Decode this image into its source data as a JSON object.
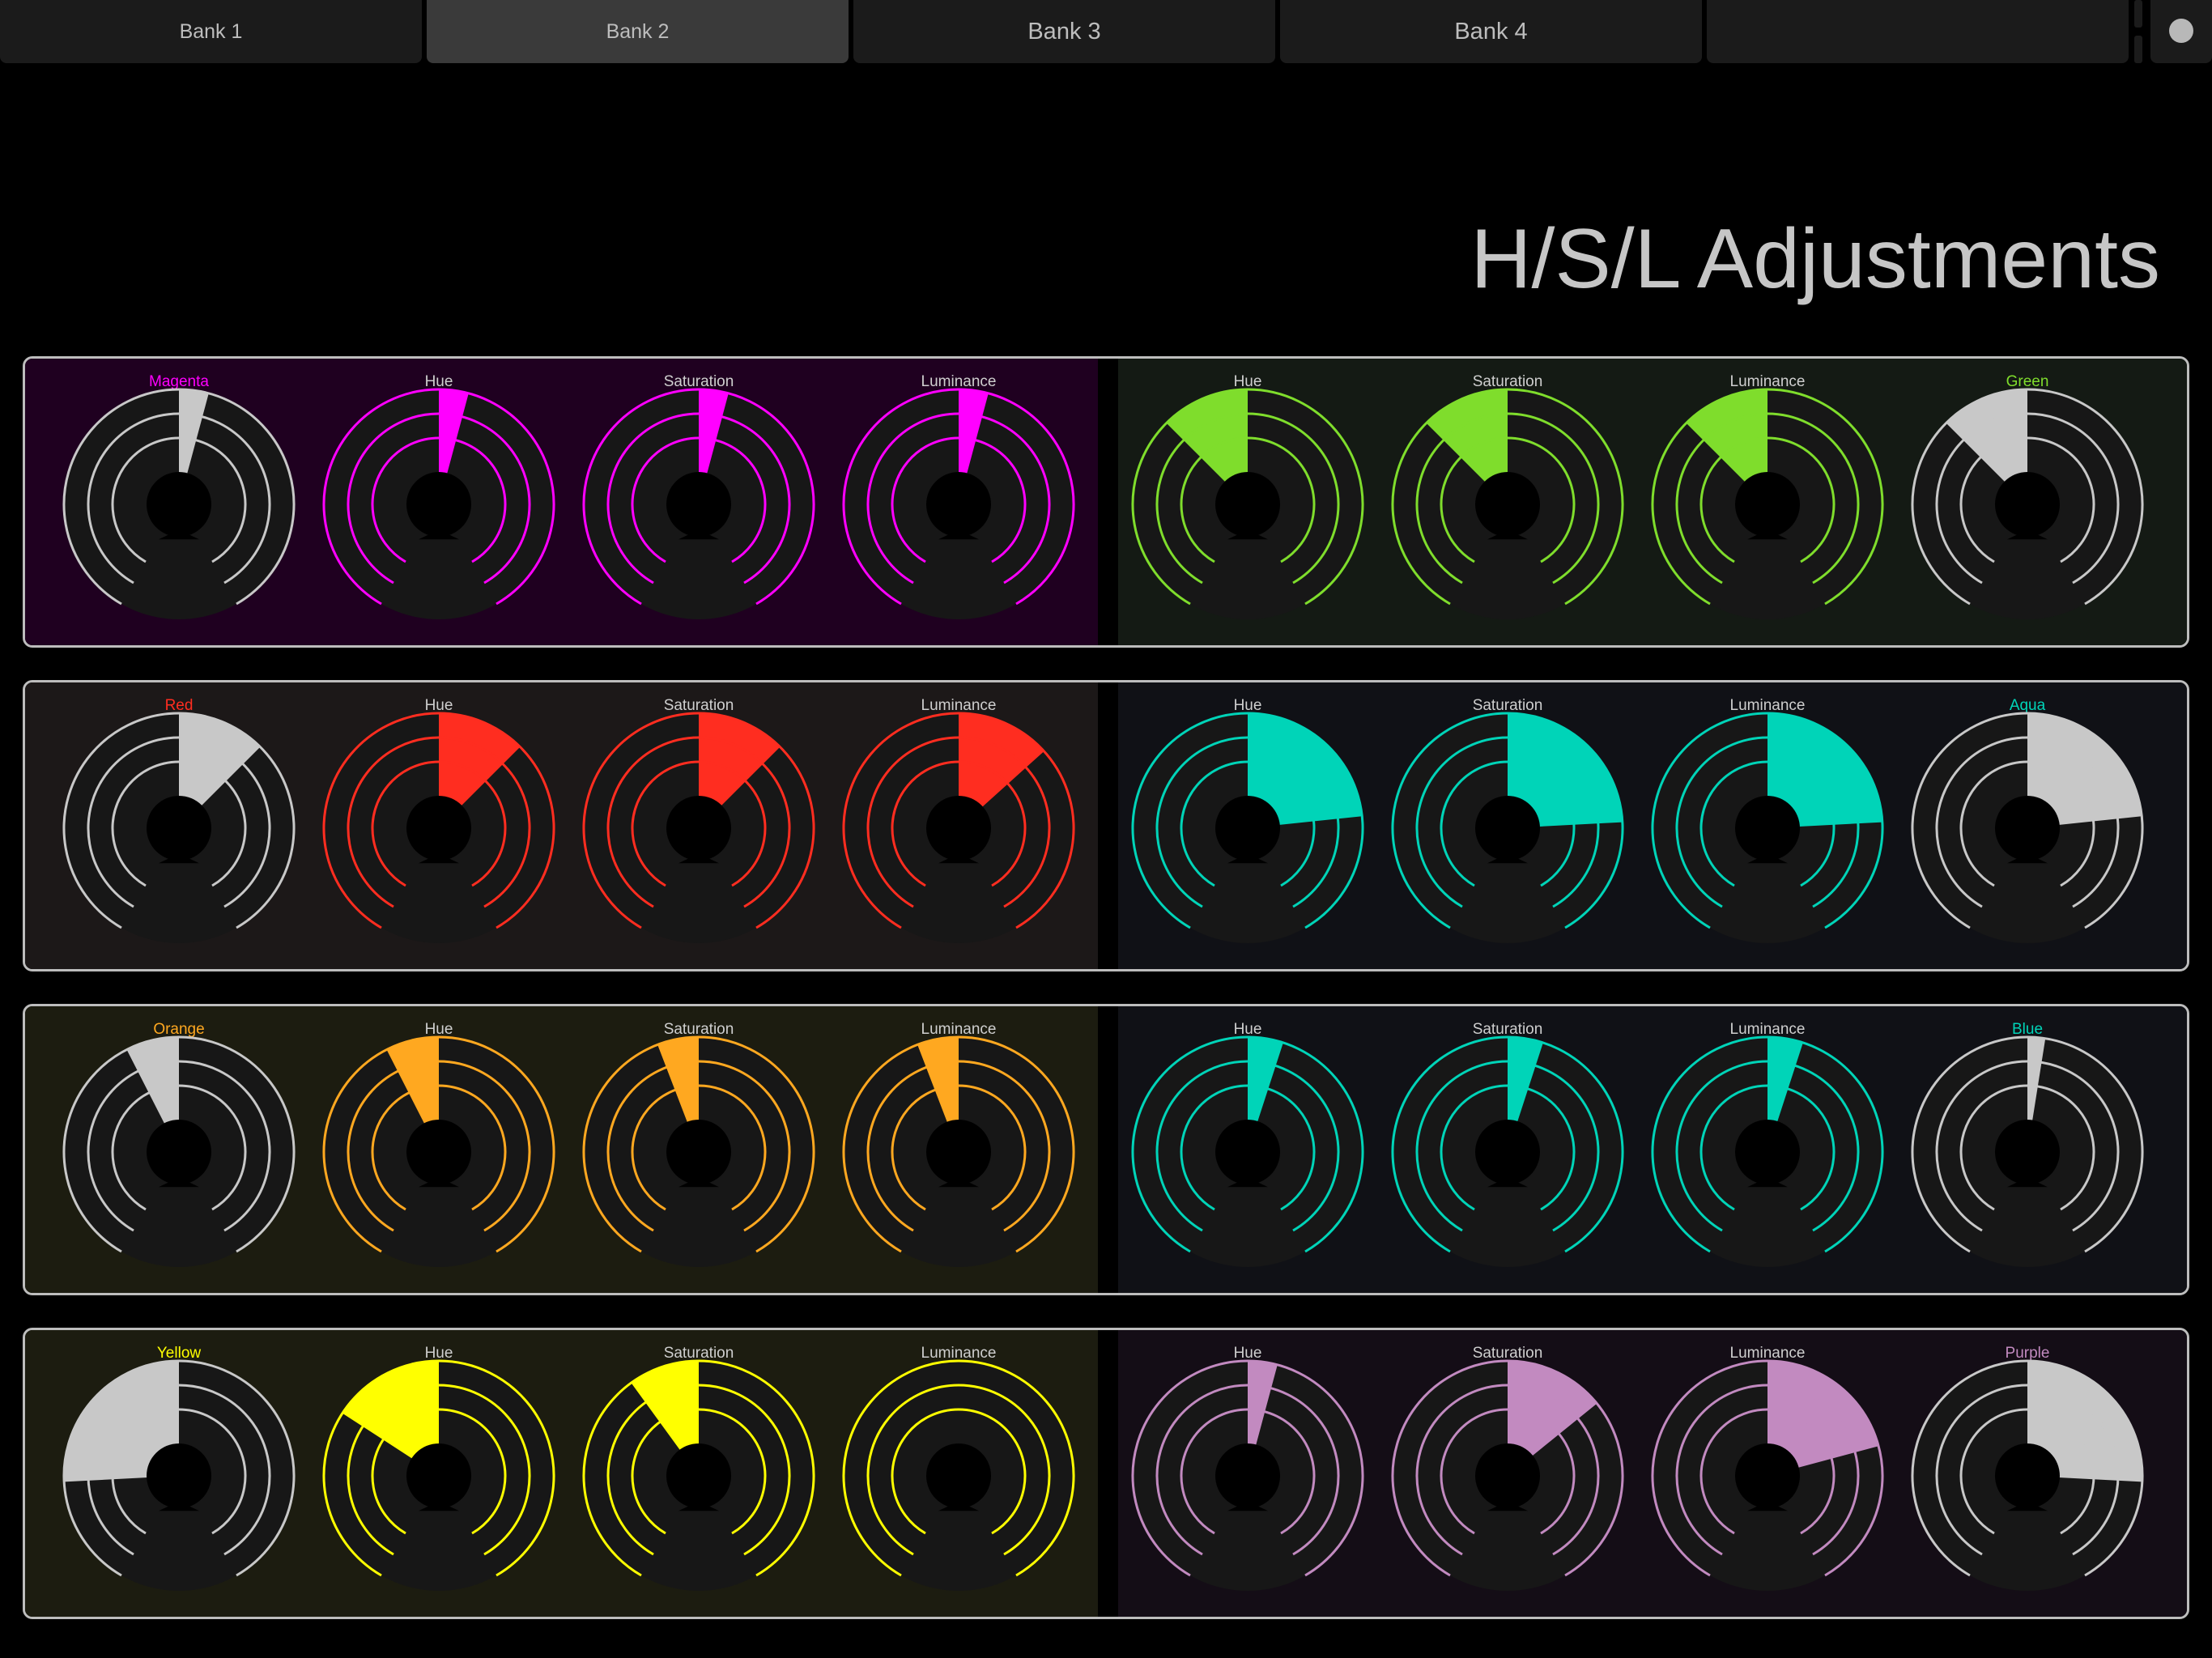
{
  "tabs": [
    {
      "label": "Bank 1",
      "active": false
    },
    {
      "label": "Bank 2",
      "active": true
    },
    {
      "label": "Bank 3",
      "active": false
    },
    {
      "label": "Bank 4",
      "active": false
    },
    {
      "label": "",
      "active": false
    }
  ],
  "status_icon": "circle-indicator-icon",
  "title": "H/S/L Adjustments",
  "rows": [
    {
      "left": {
        "bg": "#1f0020",
        "color": "#ff00ff",
        "name": "Magenta",
        "knobs": [
          {
            "label": "Magenta",
            "value": 0.55,
            "selector": true
          },
          {
            "label": "Hue",
            "value": 0.55
          },
          {
            "label": "Saturation",
            "value": 0.55
          },
          {
            "label": "Luminance",
            "value": 0.55
          }
        ]
      },
      "right": {
        "bg": "#141a14",
        "color": "#7fdd2c",
        "name": "Green",
        "knobs": [
          {
            "label": "Hue",
            "value": 0.35
          },
          {
            "label": "Saturation",
            "value": 0.35
          },
          {
            "label": "Luminance",
            "value": 0.35
          },
          {
            "label": "Green",
            "value": 0.35,
            "selector": true
          }
        ]
      }
    },
    {
      "left": {
        "bg": "#1c1818",
        "color": "#ff2d20",
        "name": "Red",
        "knobs": [
          {
            "label": "Red",
            "value": 0.65,
            "selector": true
          },
          {
            "label": "Hue",
            "value": 0.65
          },
          {
            "label": "Saturation",
            "value": 0.65
          },
          {
            "label": "Luminance",
            "value": 0.66
          }
        ]
      },
      "right": {
        "bg": "#101116",
        "color": "#00d4b8",
        "name": "Aqua",
        "knobs": [
          {
            "label": "Hue",
            "value": 0.78
          },
          {
            "label": "Saturation",
            "value": 0.79
          },
          {
            "label": "Luminance",
            "value": 0.79
          },
          {
            "label": "Aqua",
            "value": 0.78,
            "selector": true
          }
        ]
      }
    },
    {
      "left": {
        "bg": "#1c1c10",
        "color": "#ffa820",
        "name": "Orange",
        "knobs": [
          {
            "label": "Orange",
            "value": 0.41,
            "selector": true
          },
          {
            "label": "Hue",
            "value": 0.41
          },
          {
            "label": "Saturation",
            "value": 0.43
          },
          {
            "label": "Luminance",
            "value": 0.43
          }
        ]
      },
      "right": {
        "bg": "#101116",
        "color": "#00d4b8",
        "name": "Blue",
        "knobs": [
          {
            "label": "Hue",
            "value": 0.56
          },
          {
            "label": "Saturation",
            "value": 0.56
          },
          {
            "label": "Luminance",
            "value": 0.56
          },
          {
            "label": "Blue",
            "value": 0.53,
            "selector": true
          }
        ]
      }
    },
    {
      "left": {
        "bg": "#1c1c10",
        "color": "#ffff00",
        "name": "Yellow",
        "knobs": [
          {
            "label": "Yellow",
            "value": 0.19,
            "selector": true
          },
          {
            "label": "Hue",
            "value": 0.31
          },
          {
            "label": "Saturation",
            "value": 0.38
          },
          {
            "label": "Luminance",
            "value": 0.5
          }
        ]
      },
      "right": {
        "bg": "#140d16",
        "color": "#c28ac0",
        "name": "Purple",
        "knobs": [
          {
            "label": "Hue",
            "value": 0.55
          },
          {
            "label": "Saturation",
            "value": 0.67
          },
          {
            "label": "Luminance",
            "value": 0.75
          },
          {
            "label": "Purple",
            "value": 0.81,
            "selector": true
          }
        ]
      }
    }
  ],
  "selector_fill": "#c8c8c8",
  "knob_track_bg": "#171717"
}
